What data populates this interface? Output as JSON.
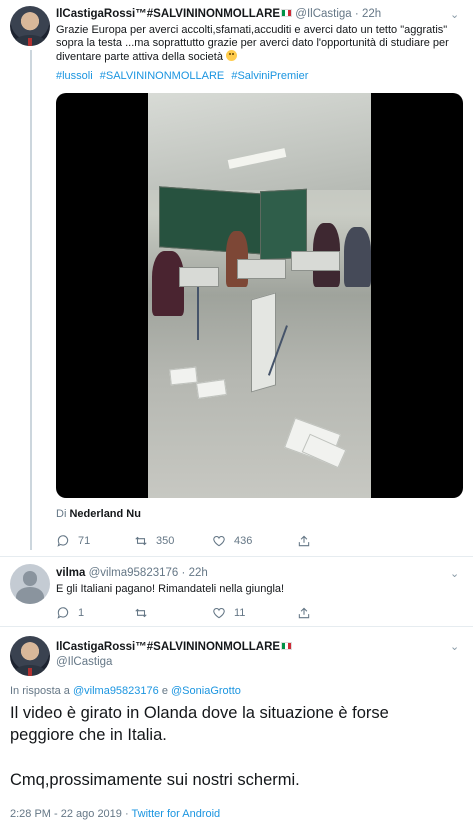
{
  "tweet1": {
    "display_name": "IlCastigaRossi™#SALVININONMOLLARE",
    "handle": "@IlCastiga",
    "separator": "·",
    "time": "22h",
    "text": "Grazie Europa per averci accolti,sfamati,accuditi e averci dato un tetto \"aggratis\" sopra la testa ...ma soprattutto grazie per averci dato l'opportunità di studiare per diventare parte attiva della società",
    "hashtags": [
      "#lussoli",
      "#SALVININONMOLLARE",
      "#SalviniPremier"
    ],
    "source_prefix": "Di",
    "source_name": "Nederland Nu",
    "replies": "71",
    "retweets": "350",
    "likes": "436"
  },
  "tweet2": {
    "display_name": "vilma",
    "handle": "@vilma95823176",
    "separator": "·",
    "time": "22h",
    "text": "E gli Italiani pagano! Rimandateli nella giungla!",
    "replies": "1",
    "retweets": "",
    "likes": "11"
  },
  "tweet3": {
    "display_name": "IlCastigaRossi™#SALVININONMOLLARE",
    "handle": "@IlCastiga",
    "reply_prefix": "In risposta a",
    "reply_user1": "@vilma95823176",
    "reply_conj": "e",
    "reply_user2": "@SoniaGrotto",
    "text_line1": "Il video è girato in Olanda dove la situazione è forse",
    "text_line2": "peggiore che in Italia.",
    "text_line3": "Cmq,prossimamente sui nostri schermi.",
    "timestamp": "2:28 PM - 22 ago 2019",
    "meta_sep": "·",
    "client": "Twitter for Android"
  },
  "colors": {
    "link": "#1b95e0",
    "muted": "#657786",
    "text": "#14171a",
    "divider": "#e6ecf0"
  },
  "icons": [
    "chevron-down-icon",
    "reply-icon",
    "retweet-icon",
    "like-icon",
    "share-icon",
    "italian-flag-icon",
    "smiling-face-emoji"
  ]
}
